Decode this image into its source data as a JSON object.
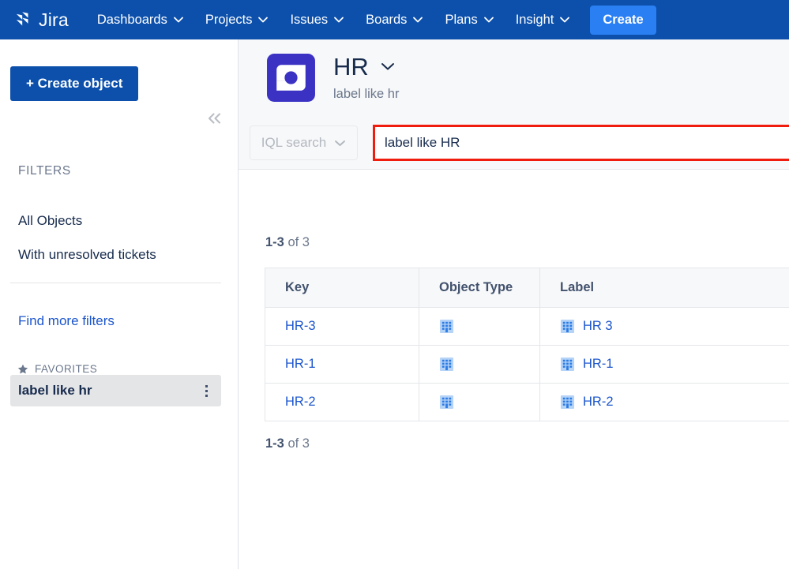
{
  "topnav": {
    "brand": "Jira",
    "brand_icon": "jira-logo-icon",
    "background_color": "#0c50ac",
    "items": [
      {
        "label": "Dashboards",
        "icon": "chevron-down-icon"
      },
      {
        "label": "Projects",
        "icon": "chevron-down-icon"
      },
      {
        "label": "Issues",
        "icon": "chevron-down-icon"
      },
      {
        "label": "Boards",
        "icon": "chevron-down-icon"
      },
      {
        "label": "Plans",
        "icon": "chevron-down-icon"
      },
      {
        "label": "Insight",
        "icon": "chevron-down-icon"
      }
    ],
    "create_label": "Create",
    "create_color": "#2a7ff3"
  },
  "sidebar": {
    "create_object_label": "+ Create object",
    "create_object_color": "#0c50ac",
    "collapse_icon": "chevron-double-left-icon",
    "filters_heading": "FILTERS",
    "filters": [
      {
        "label": "All Objects"
      },
      {
        "label": "With unresolved tickets"
      }
    ],
    "find_more_filters": "Find more filters",
    "find_more_color": "#1b55cc",
    "favorites_heading": "FAVORITES",
    "favorites_icon": "star-icon",
    "favorites": [
      {
        "label": "label like hr",
        "more_icon": "more-vertical-icon",
        "selected": true
      }
    ]
  },
  "header": {
    "object_icon": "insight-object-schema-icon",
    "object_icon_color": "#3b32c4",
    "title": "HR",
    "title_caret": "chevron-down-icon",
    "subtitle": "label like hr"
  },
  "search": {
    "mode_label": "IQL search",
    "mode_caret": "chevron-down-icon",
    "query_value": "label like HR",
    "query_placeholder": "",
    "highlight_color": "#f01c0d"
  },
  "results": {
    "count_range": "1-3",
    "count_suffix": "of 3",
    "columns": [
      "Key",
      "Object Type",
      "Label"
    ],
    "rows": [
      {
        "key": "HR-3",
        "type_icon": "building-icon",
        "label_icon": "building-icon",
        "label": "HR 3"
      },
      {
        "key": "HR-1",
        "type_icon": "building-icon",
        "label_icon": "building-icon",
        "label": "HR-1"
      },
      {
        "key": "HR-2",
        "type_icon": "building-icon",
        "label_icon": "building-icon",
        "label": "HR-2"
      }
    ]
  }
}
